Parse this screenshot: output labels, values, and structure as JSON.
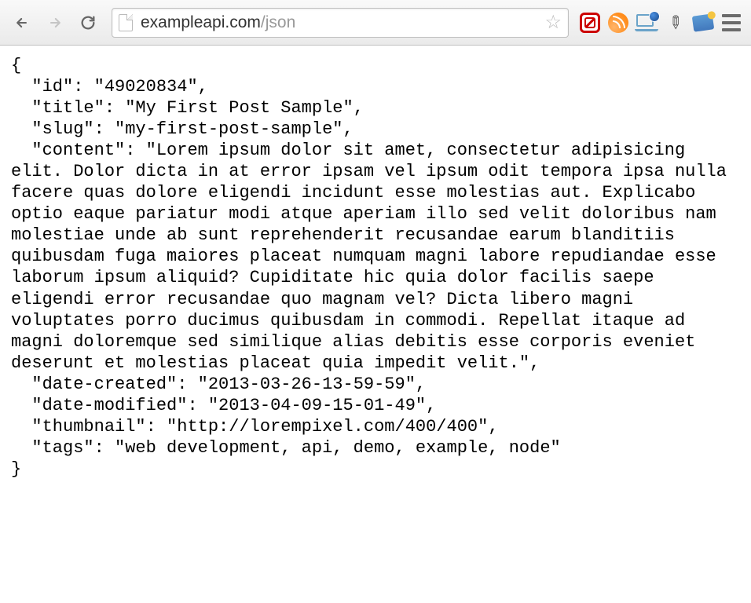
{
  "browser": {
    "url_domain": "exampleapi.com",
    "url_path": "/json"
  },
  "json": {
    "open_brace": "{",
    "close_brace": "}",
    "fields": {
      "id_key": "\"id\"",
      "id_val": "\"49020834\"",
      "title_key": "\"title\"",
      "title_val": "\"My First Post Sample\"",
      "slug_key": "\"slug\"",
      "slug_val": "\"my-first-post-sample\"",
      "content_key": "\"content\"",
      "content_val": "\"Lorem ipsum dolor sit amet, consectetur adipisicing elit. Dolor dicta in at error ipsam vel ipsum odit tempora ipsa nulla facere quas dolore eligendi incidunt esse molestias aut. Explicabo optio eaque pariatur modi atque aperiam illo sed velit doloribus nam molestiae unde ab sunt reprehenderit recusandae earum blanditiis quibusdam fuga maiores placeat numquam magni labore repudiandae esse laborum ipsum aliquid? Cupiditate hic quia dolor facilis saepe eligendi error recusandae quo magnam vel? Dicta libero magni voluptates porro ducimus quibusdam in commodi. Repellat itaque ad magni doloremque sed similique alias debitis esse corporis eveniet deserunt et molestias placeat quia impedit velit.\"",
      "date_created_key": "\"date-created\"",
      "date_created_val": "\"2013-03-26-13-59-59\"",
      "date_modified_key": "\"date-modified\"",
      "date_modified_val": "\"2013-04-09-15-01-49\"",
      "thumbnail_key": "\"thumbnail\"",
      "thumbnail_val": "\"http://lorempixel.com/400/400\"",
      "tags_key": "\"tags\"",
      "tags_val": "\"web development, api, demo, example, node\""
    }
  }
}
